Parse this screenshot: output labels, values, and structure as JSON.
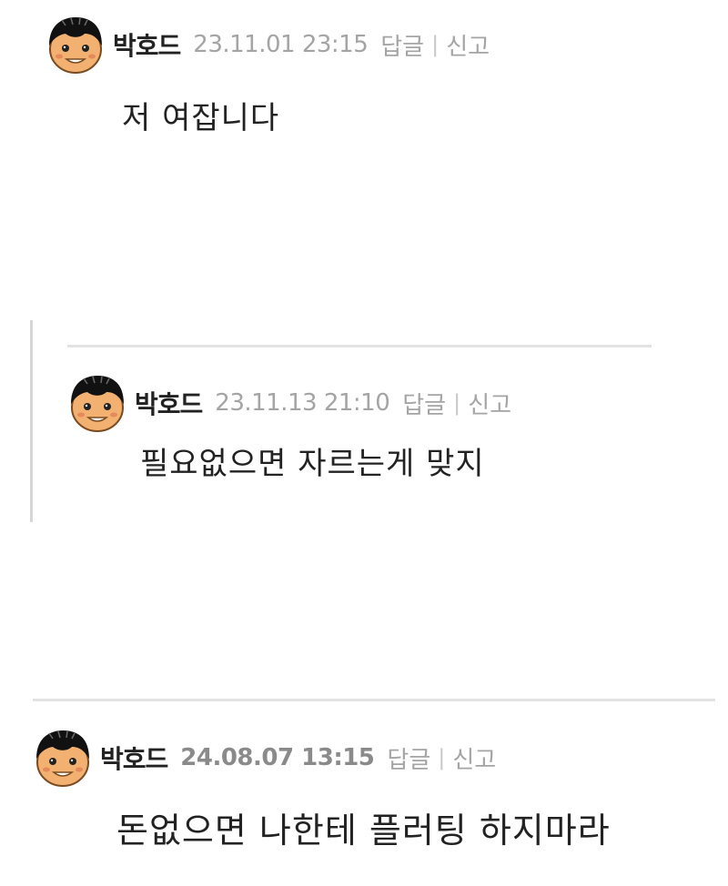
{
  "comments": [
    {
      "nickname": "박호드",
      "date": "23.11.01 23:15",
      "reply": "답글",
      "separator": "|",
      "report": "신고",
      "body": "저 여잡니다"
    },
    {
      "nickname": "박호드",
      "date": "23.11.13 21:10",
      "reply": "답글",
      "separator": "|",
      "report": "신고",
      "body": "필요없으면 자르는게 맞지"
    },
    {
      "nickname": "박호드",
      "date": "24.08.07 13:15",
      "reply": "답글",
      "separator": "|",
      "report": "신고",
      "body": "돈없으면 나한테 플러팅 하지마라"
    }
  ],
  "icons": {
    "avatar": "cartoon-boy-face-icon"
  },
  "colors": {
    "nickname": "#222222",
    "meta": "#a4a4a4",
    "divider": "#e2e2e2",
    "reply_bar": "#d6d6d6",
    "avatar_skin": "#f2b071",
    "avatar_hair": "#111111"
  }
}
